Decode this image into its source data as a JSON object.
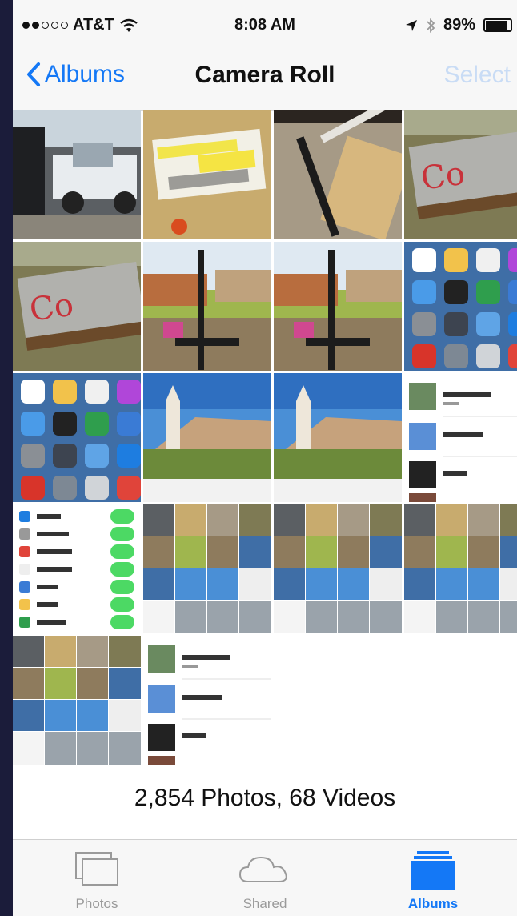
{
  "status_bar": {
    "carrier": "AT&T",
    "time": "8:08 AM",
    "battery": "89%",
    "battery_level": 0.89
  },
  "nav": {
    "back_label": "Albums",
    "title": "Camera Roll",
    "select_label": "Select"
  },
  "photos": [
    "pickup-truck-photo",
    "price-tag-photo",
    "easel-photo",
    "sign-board-photo",
    "sign-board-photo",
    "yard-sale-photo",
    "yard-sale-photo",
    "home-screen-screenshot",
    "home-screen-screenshot",
    "church-photo",
    "church-photo",
    "albums-list-screenshot",
    "settings-screenshot",
    "thumbnail-grid-screenshot",
    "thumbnail-grid-screenshot",
    "thumbnail-grid-screenshot",
    "thumbnail-grid-screenshot",
    "albums-list-screenshot"
  ],
  "counts_text": "2,854 Photos, 68 Videos",
  "colors": {
    "accent": "#1478f6",
    "inactive": "#9a9a9a"
  },
  "tabs": [
    {
      "label": "Photos",
      "icon": "photos-icon",
      "active": false
    },
    {
      "label": "Shared",
      "icon": "cloud-icon",
      "active": false
    },
    {
      "label": "Albums",
      "icon": "albums-icon",
      "active": true
    }
  ]
}
